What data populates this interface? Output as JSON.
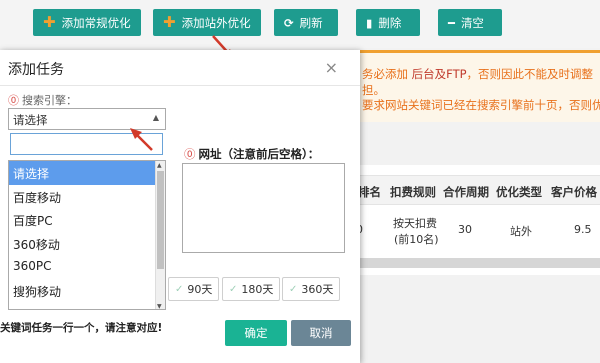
{
  "toolbar": {
    "buttons": [
      {
        "label": "添加常规优化",
        "icon": "plus-icon"
      },
      {
        "label": "添加站外优化",
        "icon": "plus-icon"
      },
      {
        "label": "刷新",
        "icon": "refresh-icon"
      },
      {
        "label": "删除",
        "icon": "trash-icon"
      },
      {
        "label": "清空",
        "icon": "minus-icon"
      }
    ]
  },
  "notice": {
    "line1_a": "务必添加 ",
    "line1_b": "后台及FTP",
    "line1_c": "，否则因此不能及时调整",
    "line2": "担。",
    "line3": "要求网站关键词已经在搜索引擎前十页，否则优"
  },
  "table": {
    "headers": [
      "排名",
      "扣费规则",
      "合作周期",
      "优化类型",
      "客户价格"
    ],
    "row": {
      "rank": "0",
      "rule_line1": "按天扣费",
      "rule_line2": "(前10名)",
      "period": "30",
      "type": "站外",
      "price": "9.5"
    }
  },
  "modal": {
    "title": "添加任务",
    "close": "×",
    "engine_label": "搜索引擎：",
    "engine_selected": "请选择",
    "search_value": "",
    "options": [
      "请选择",
      "百度移动",
      "百度PC",
      "360移动",
      "360PC",
      "搜狗移动"
    ],
    "url_label": "网址（注意前后空格）：",
    "days": [
      "90天",
      "180天",
      "360天"
    ],
    "foot_note": "关键词任务一行一个，请注意对应!",
    "ok": "确定",
    "cancel": "取消"
  },
  "colors": {
    "primary": "#1e9c8f",
    "accent": "#f0a030",
    "warning_text": "#e8711c",
    "selected_option": "#5d9cec",
    "ok_button": "#1ab394",
    "cancel_button": "#6b8696",
    "arrow": "#d23a2a"
  }
}
